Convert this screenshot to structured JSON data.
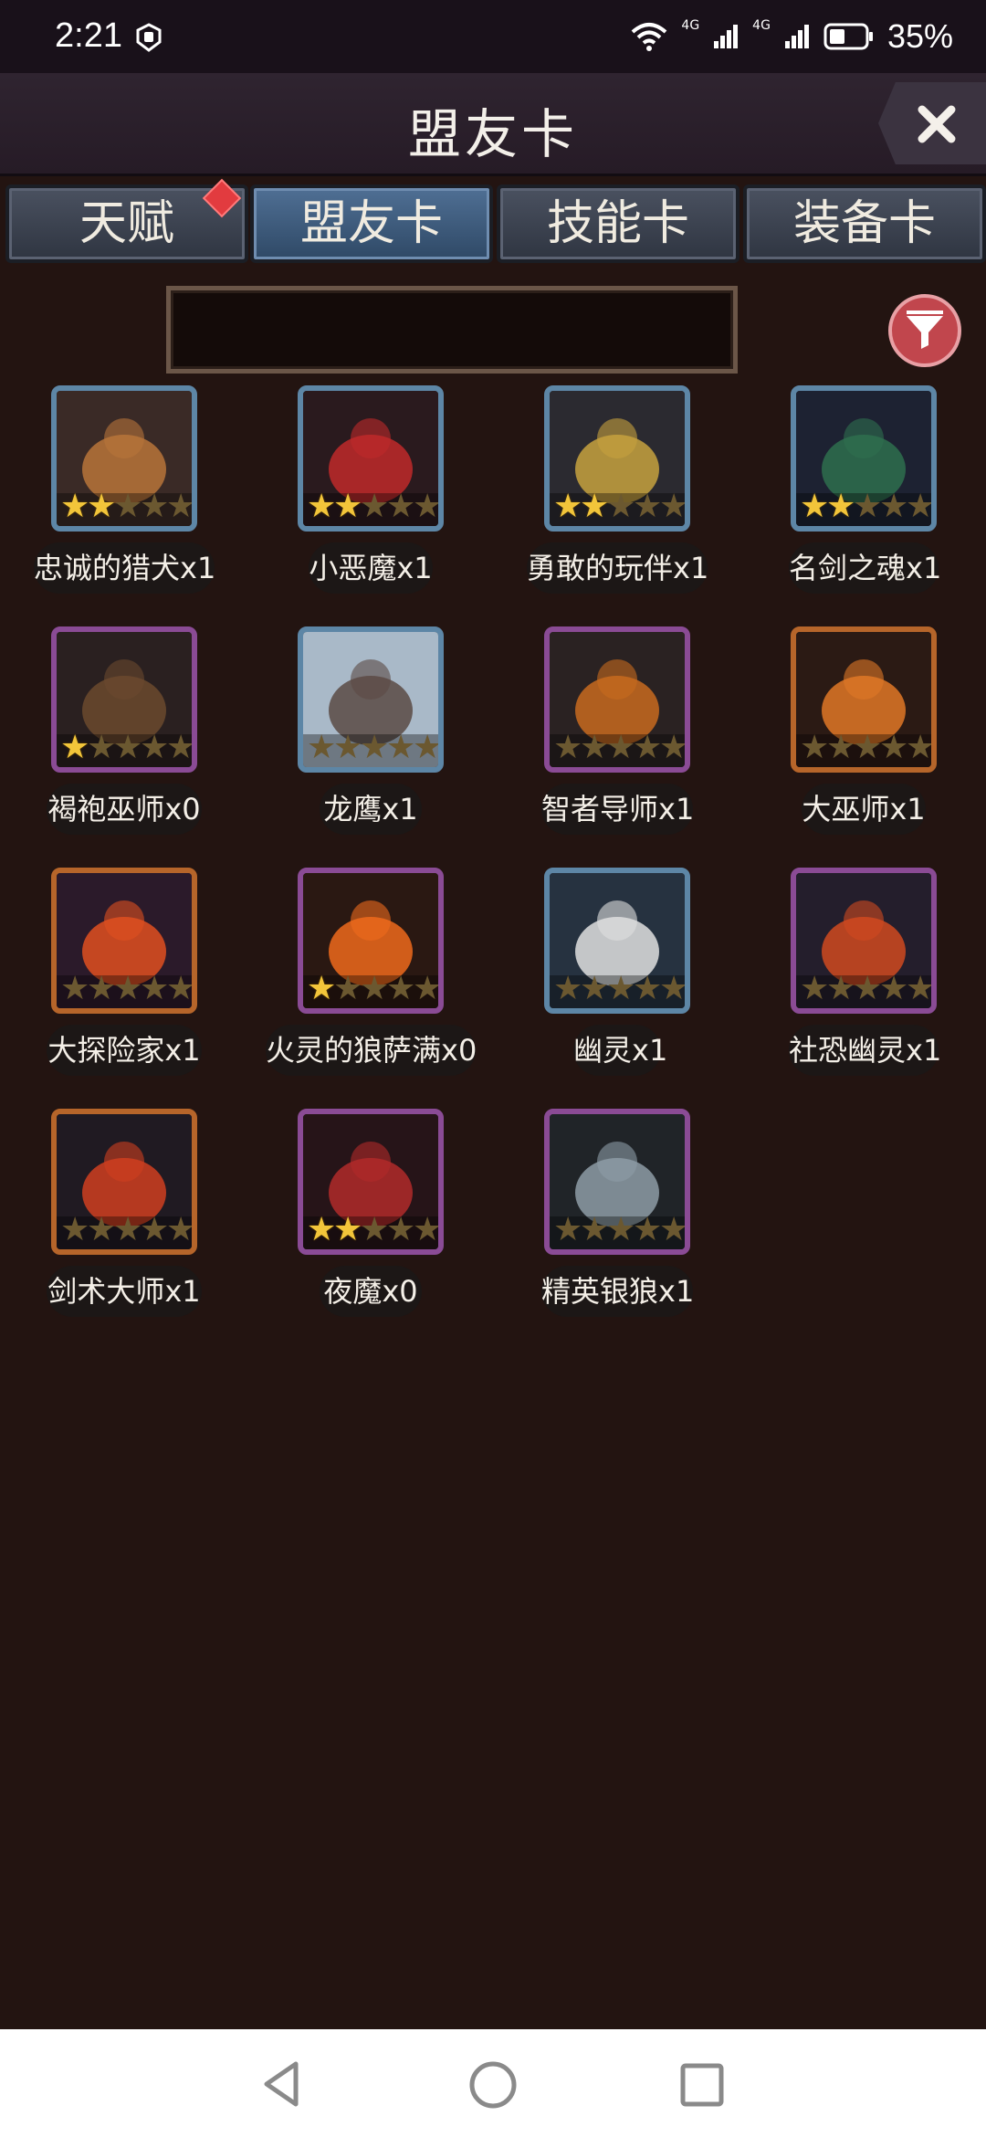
{
  "status": {
    "time": "2:21",
    "battery": "35%",
    "signal_label_1": "4G",
    "signal_label_2": "4G"
  },
  "header": {
    "title": "盟友卡",
    "close_icon": "close-icon"
  },
  "tabs": [
    {
      "label": "天赋",
      "badge": true
    },
    {
      "label": "盟友卡",
      "active": true
    },
    {
      "label": "技能卡"
    },
    {
      "label": "装备卡"
    }
  ],
  "search": {
    "value": "",
    "placeholder": ""
  },
  "cards": [
    {
      "label": "忠诚的猎犬x1",
      "stars": 2,
      "rarity": "blue"
    },
    {
      "label": "小恶魔x1",
      "stars": 2,
      "rarity": "blue"
    },
    {
      "label": "勇敢的玩伴x1",
      "stars": 2,
      "rarity": "blue"
    },
    {
      "label": "名剑之魂x1",
      "stars": 2,
      "rarity": "blue"
    },
    {
      "label": "褐袍巫师x0",
      "stars": 1,
      "rarity": "purple"
    },
    {
      "label": "龙鹰x1",
      "stars": 0,
      "rarity": "blue"
    },
    {
      "label": "智者导师x1",
      "stars": 0,
      "rarity": "purple"
    },
    {
      "label": "大巫师x1",
      "stars": 0,
      "rarity": "orange"
    },
    {
      "label": "大探险家x1",
      "stars": 0,
      "rarity": "orange"
    },
    {
      "label": "火灵的狼萨满x0",
      "stars": 1,
      "rarity": "purple"
    },
    {
      "label": "幽灵x1",
      "stars": 0,
      "rarity": "blue"
    },
    {
      "label": "社恐幽灵x1",
      "stars": 0,
      "rarity": "purple"
    },
    {
      "label": "剑术大师x1",
      "stars": 0,
      "rarity": "orange"
    },
    {
      "label": "夜魔x0",
      "stars": 2,
      "rarity": "purple"
    },
    {
      "label": "精英银狼x1",
      "stars": 0,
      "rarity": "purple"
    }
  ]
}
